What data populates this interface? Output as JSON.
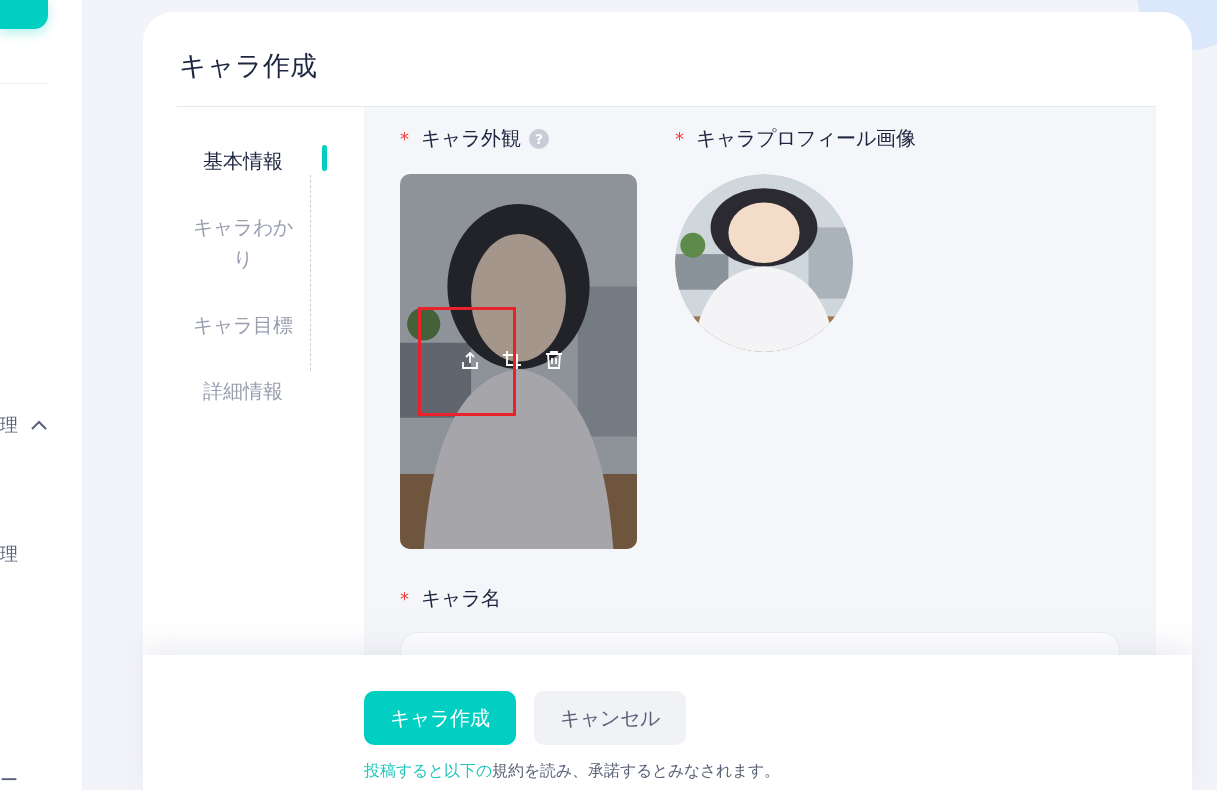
{
  "sidebar": {
    "items": [
      {
        "label": "理",
        "expanded": true
      },
      {
        "label": "理"
      },
      {
        "label": "ー"
      }
    ]
  },
  "page": {
    "title": "キャラ作成"
  },
  "steps": [
    {
      "label": "基本情報",
      "selected": true
    },
    {
      "label": "キャラわかり",
      "selected": false
    },
    {
      "label": "キャラ目標",
      "selected": false
    },
    {
      "label": "詳細情報",
      "selected": false
    }
  ],
  "fields": [
    {
      "kind": "appearance",
      "required_mark": "*",
      "label": "キャラ外観",
      "help": "?"
    },
    {
      "kind": "avatar",
      "required_mark": "*",
      "label": "キャラプロフィール画像"
    },
    {
      "kind": "name",
      "required_mark": "*",
      "label": "キャラ名"
    }
  ],
  "footer": {
    "buttons": [
      {
        "label": "キャラ作成",
        "kind": "primary"
      },
      {
        "label": "キャンセル",
        "kind": "secondary"
      }
    ],
    "terms": {
      "link": "投稿すると以下の",
      "text": "規約を読み、承諾するとみなされます。"
    }
  }
}
